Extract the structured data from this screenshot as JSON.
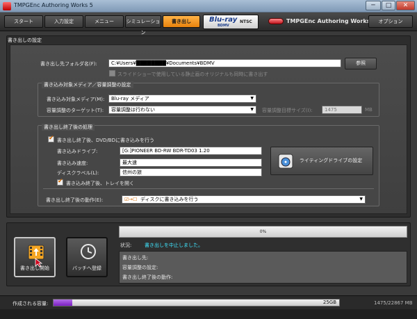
{
  "window": {
    "title": "TMPGEnc Authoring Works 5",
    "buttons": [
      "─",
      "□",
      "✕"
    ]
  },
  "nav": {
    "tabs": [
      "スタート",
      "入力設定",
      "メニュー",
      "シミュレーション",
      "書き出し"
    ],
    "active_tab": "書き出し",
    "brand_text": "Blu-ray",
    "brand_sub": "BDMV",
    "brand_format": "NTSC",
    "logo_text": "TMPGEnc Authoring Works 5",
    "options_label": "オプション"
  },
  "export_settings": {
    "panel_title": "書き出しの設定",
    "folder_label": "書き出し先フォルダ名(F):",
    "folder_value": "C:¥Users¥████████¥Documents¥BDMV",
    "browse_button": "参照",
    "slideshow_checkbox": "スライドショーで使用している静止画のオリジナルも同時に書き出す",
    "media_group": {
      "title": "書き込み対象メディア／容量調整の設定",
      "media_label": "書き込み対象メディア(M):",
      "media_value": "Blu-ray メディア",
      "target_label": "容量調整のターゲット(T):",
      "target_value": "容量調整は行わない",
      "size_label": "容量調整目標サイズ(I):",
      "size_value": "1475",
      "size_unit": "MB"
    },
    "post_group": {
      "title": "書き出し終了後の処理",
      "write_checkbox": "書き出し終了後、DVD/BDに書き込みを行う",
      "drive_label": "書き込みドライブ:",
      "drive_value": "[G:]PIONEER BD-RW   BDR-TD03 1.20",
      "speed_label": "書き込み速度:",
      "speed_value": "最大速",
      "disc_label_label": "ディスクラベル(L):",
      "disc_label_value": "信州の旅",
      "tray_checkbox": "書き込み終了後、トレイを開く",
      "writing_drive_button": "ライティングドライブの設定",
      "action_label": "書き出し終了後の動作(E):",
      "action_value": "ディスクに書き込みを行う"
    }
  },
  "bottom": {
    "start_button": "書き出し開始",
    "batch_button": "バッチへ登録",
    "progress_text": "0%",
    "progress": 0,
    "status_label": "状況:",
    "status_text": "書き出しを中止しました。",
    "info_lines": [
      "書き出し先:",
      "容量調整の設定:",
      "書き出し終了後の動作:"
    ]
  },
  "footer": {
    "capacity_label": "作成される容量:",
    "capacity_bar_text": "25GB",
    "capacity_value": "1475/22867 MB",
    "capacity_fraction": 0.065
  },
  "colors": {
    "accent": "#e8820c",
    "status": "#3fe6ff",
    "capacity": "#7a1fc2"
  }
}
